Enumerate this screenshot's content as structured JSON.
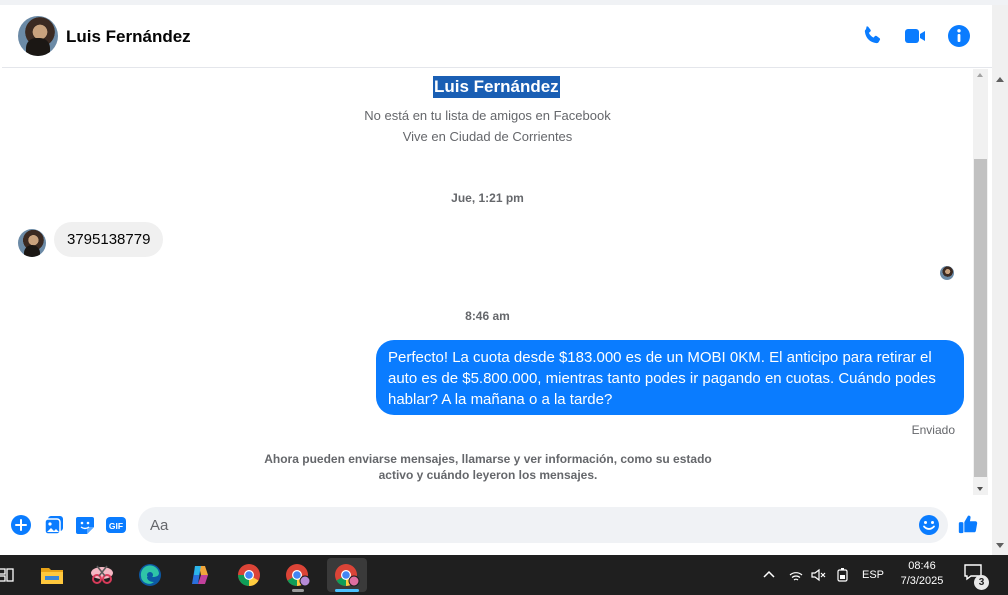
{
  "header": {
    "contact_name": "Luis Fernández",
    "icons": [
      "phone-icon",
      "video-call-icon",
      "info-icon"
    ],
    "accent_color": "#0a7cff"
  },
  "intro": {
    "name": "Luis Fernández",
    "line1": "No está en tu lista de amigos en Facebook",
    "line2": "Vive en Ciudad de Corrientes"
  },
  "messages": {
    "timestamp1": "Jue, 1:21 pm",
    "incoming_text": "3795138779",
    "timestamp2": "8:46 am",
    "outgoing_text": "Perfecto! La cuota desde $183.000 es de un MOBI 0KM. El anticipo para retirar el auto es de $5.800.000, mientras tanto podes ir pagando en cuotas. Cuándo podes hablar? A la mañana o a la tarde?",
    "status": "Enviado",
    "notice": "Ahora pueden enviarse mensajes, llamarse y ver información, como su estado activo y cuándo leyeron los mensajes."
  },
  "composer": {
    "placeholder": "Aa",
    "icons": [
      "plus-icon",
      "photo-icon",
      "sticker-icon",
      "gif-icon",
      "emoji-icon",
      "like-icon"
    ],
    "gif_label": "GIF"
  },
  "taskbar": {
    "apps": [
      "task-view-icon",
      "file-explorer-icon",
      "snipping-tool-icon",
      "edge-icon",
      "copilot-icon",
      "chrome-icon",
      "chrome-profile-icon",
      "chrome-profile-active-icon"
    ],
    "language": "ESP",
    "time": "08:46",
    "date": "7/3/2025",
    "notification_count": "3"
  }
}
